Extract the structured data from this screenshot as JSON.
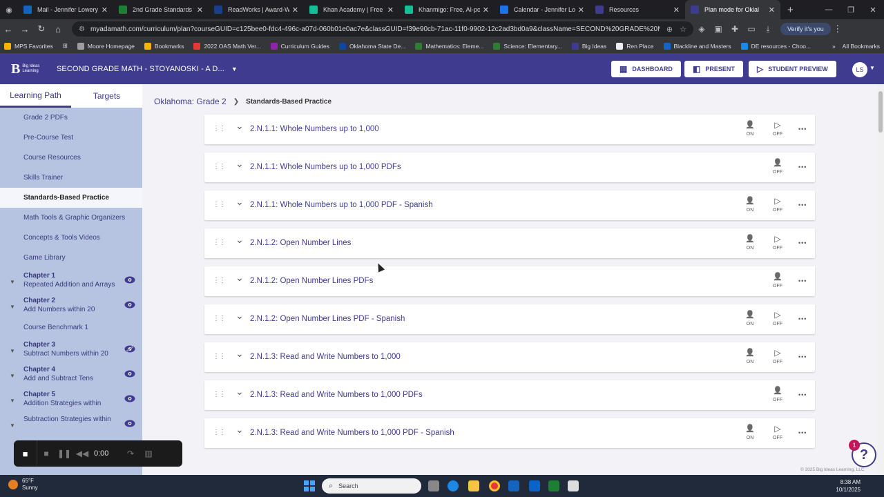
{
  "browser": {
    "tabs": [
      {
        "label": "Mail - Jennifer Lowery - O",
        "color": "#1565c0",
        "active": false
      },
      {
        "label": "2nd Grade Standards for",
        "color": "#1e7e34",
        "active": false
      },
      {
        "label": "ReadWorks | Award-Win",
        "color": "#1a3f8a",
        "active": false
      },
      {
        "label": "Khan Academy | Free O",
        "color": "#14bf96",
        "active": false
      },
      {
        "label": "Khanmigo: Free, AI-pow",
        "color": "#14bf96",
        "active": false
      },
      {
        "label": "Calendar - Jennifer Lowe",
        "color": "#1a73e8",
        "active": false
      },
      {
        "label": "Resources",
        "color": "#3f3b8f",
        "active": false
      },
      {
        "label": "Plan mode for Oklal",
        "color": "#3f3b8f",
        "active": true
      }
    ],
    "url": "myadamath.com/curriculum/plan?courseGUID=c125bee0-fdc4-496c-a07d-060b01e0ac7e&classGUID=f39e90cb-71ac-11f0-9902-12c2ad3bd0a9&className=SECOND%20GRADE%20MATH%20-%...",
    "verify_label": "Verify it's you",
    "bookmarks": [
      {
        "label": "MPS Favorites",
        "color": "#f4b400"
      },
      {
        "label": "Moore Homepage",
        "color": "#9e9e9e"
      },
      {
        "label": "Bookmarks",
        "color": "#f4b400"
      },
      {
        "label": "2022 OAS Math Ver...",
        "color": "#e53935"
      },
      {
        "label": "Curriculum Guides",
        "color": "#8e24aa"
      },
      {
        "label": "Oklahoma State De...",
        "color": "#0d47a1"
      },
      {
        "label": "Mathematics: Eleme...",
        "color": "#2e7d32"
      },
      {
        "label": "Science: Elementary...",
        "color": "#2e7d32"
      },
      {
        "label": "Big Ideas",
        "color": "#3f3b8f"
      },
      {
        "label": "Ren Place",
        "color": "#eeeeee"
      },
      {
        "label": "Blackline and Masters",
        "color": "#1565c0"
      },
      {
        "label": "DE resources - Choo...",
        "color": "#1e88e5"
      }
    ],
    "all_bookmarks": "All Bookmarks"
  },
  "app": {
    "logo_text": "Big Ideas Learning",
    "course_title": "SECOND GRADE MATH - STOYANOSKI - A D...",
    "dashboard": "DASHBOARD",
    "present": "PRESENT",
    "student_preview": "STUDENT PREVIEW",
    "avatar_initials": "LS",
    "accent": "#3f3b8f"
  },
  "sidebar": {
    "tab_learning_path": "Learning Path",
    "tab_targets": "Targets",
    "items": [
      {
        "label": "Grade 2 PDFs"
      },
      {
        "label": "Pre-Course Test"
      },
      {
        "label": "Course Resources"
      },
      {
        "label": "Skills Trainer"
      },
      {
        "label": "Standards-Based Practice",
        "active": true
      },
      {
        "label": "Math Tools & Graphic Organizers"
      },
      {
        "label": "Concepts & Tools Videos"
      },
      {
        "label": "Game Library"
      }
    ],
    "chapters": [
      {
        "title": "Chapter 1",
        "subtitle": "Repeated Addition and Arrays",
        "visible": true
      },
      {
        "title": "Chapter 2",
        "subtitle": "Add Numbers within 20",
        "visible": true
      },
      {
        "title": "Chapter 3",
        "subtitle": "Subtract Numbers within 20",
        "visible": false
      },
      {
        "title": "Chapter 4",
        "subtitle": "Add and Subtract Tens",
        "visible": true
      },
      {
        "title": "Chapter 5",
        "subtitle": "Addition Strategies within",
        "visible": true
      },
      {
        "title": "",
        "subtitle": "Subtraction Strategies within",
        "visible": true
      }
    ],
    "benchmark": "Course Benchmark 1"
  },
  "breadcrumb": {
    "parent": "Oklahoma: Grade 2",
    "current": "Standards-Based Practice"
  },
  "practice_rows": [
    {
      "title": "2.N.1.1: Whole Numbers up to 1,000",
      "on": "ON",
      "off": "OFF",
      "has_on": true
    },
    {
      "title": "2.N.1.1: Whole Numbers up to 1,000 PDFs",
      "on": "",
      "off": "OFF",
      "has_on": false
    },
    {
      "title": "2.N.1.1: Whole Numbers up to 1,000 PDF - Spanish",
      "on": "ON",
      "off": "OFF",
      "has_on": true
    },
    {
      "title": "2.N.1.2: Open Number Lines",
      "on": "ON",
      "off": "OFF",
      "has_on": true
    },
    {
      "title": "2.N.1.2: Open Number Lines PDFs",
      "on": "",
      "off": "OFF",
      "has_on": false
    },
    {
      "title": "2.N.1.2: Open Number Lines PDF - Spanish",
      "on": "ON",
      "off": "OFF",
      "has_on": true
    },
    {
      "title": "2.N.1.3: Read and Write Numbers to 1,000",
      "on": "ON",
      "off": "OFF",
      "has_on": true
    },
    {
      "title": "2.N.1.3: Read and Write Numbers to 1,000 PDFs",
      "on": "",
      "off": "OFF",
      "has_on": false
    },
    {
      "title": "2.N.1.3: Read and Write Numbers to 1,000 PDF - Spanish",
      "on": "ON",
      "off": "OFF",
      "has_on": true
    }
  ],
  "recorder": {
    "time": "0:00"
  },
  "help": {
    "badge": "1",
    "symbol": "?"
  },
  "copyright": "© 2025 Big Ideas Learning, LLC",
  "taskbar": {
    "temp": "65°F",
    "weather": "Sunny",
    "search": "Search",
    "time": "8:38 AM",
    "date": "10/1/2025"
  }
}
